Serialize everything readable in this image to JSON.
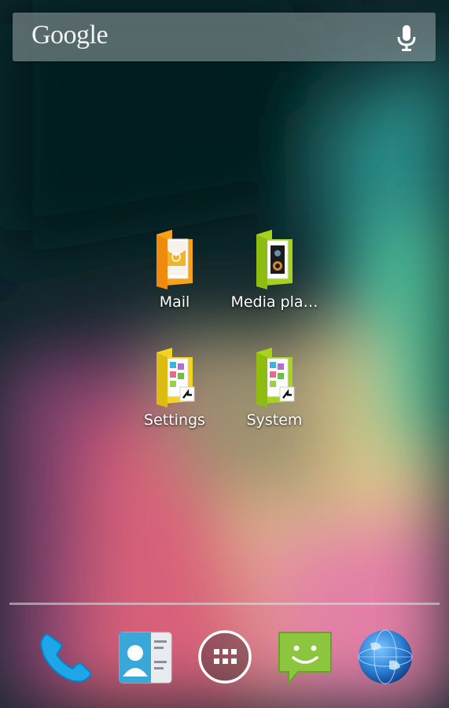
{
  "search": {
    "logo_text": "Google",
    "mic_icon": "microphone-icon"
  },
  "folders": [
    {
      "label": "Mail",
      "icon": "mail-folder-icon",
      "color": "#f4a11a"
    },
    {
      "label": "Media pla…",
      "icon": "media-folder-icon",
      "color": "#a3cf1f"
    },
    {
      "label": "Settings",
      "icon": "settings-folder-icon",
      "color": "#f2d121"
    },
    {
      "label": "System",
      "icon": "system-folder-icon",
      "color": "#a8d11e"
    }
  ],
  "dock": [
    {
      "name": "Phone",
      "icon": "phone-icon",
      "color": "#1da6e8"
    },
    {
      "name": "Contacts",
      "icon": "contacts-icon",
      "color": "#39a7d8"
    },
    {
      "name": "All apps",
      "icon": "app-drawer-icon",
      "color": "#ffffff"
    },
    {
      "name": "Messaging",
      "icon": "messaging-icon",
      "color": "#8cc63f"
    },
    {
      "name": "Browser",
      "icon": "globe-icon",
      "color": "#2b7fd4"
    }
  ]
}
